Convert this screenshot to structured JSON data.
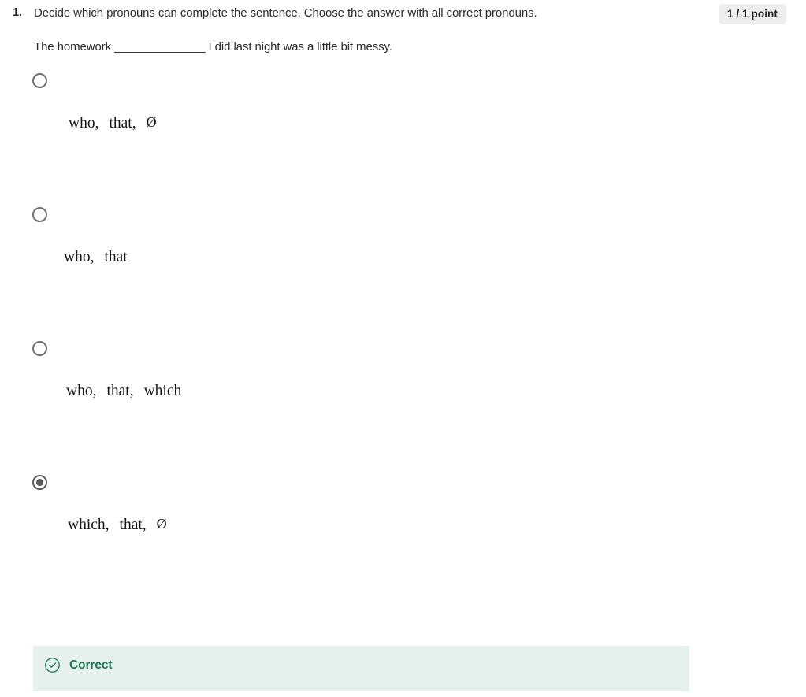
{
  "question": {
    "number": "1.",
    "prompt": "Decide which pronouns can complete the sentence. Choose the answer with all correct pronouns.",
    "sentence": "The homework ______________ I did last night was a little bit messy.",
    "points_badge": "1 / 1 point"
  },
  "options": [
    {
      "id": "option-a",
      "selected": false,
      "indent": 87,
      "tokens": [
        "who,",
        "that,",
        "Ø"
      ],
      "text": "who,  that,  Ø"
    },
    {
      "id": "option-b",
      "selected": false,
      "indent": 81,
      "tokens": [
        "who,",
        "that"
      ],
      "text": "who,  that"
    },
    {
      "id": "option-c",
      "selected": false,
      "indent": 84,
      "tokens": [
        "who,",
        "that,",
        "which"
      ],
      "text": "who,  that,  which"
    },
    {
      "id": "option-d",
      "selected": true,
      "indent": 86,
      "tokens": [
        "which,",
        "that,",
        "Ø"
      ],
      "text": "which,  that,  Ø"
    }
  ],
  "feedback": {
    "icon": "check-circle-icon",
    "label": "Correct",
    "background_color": "#e6f0ec",
    "text_color": "#177a52"
  }
}
